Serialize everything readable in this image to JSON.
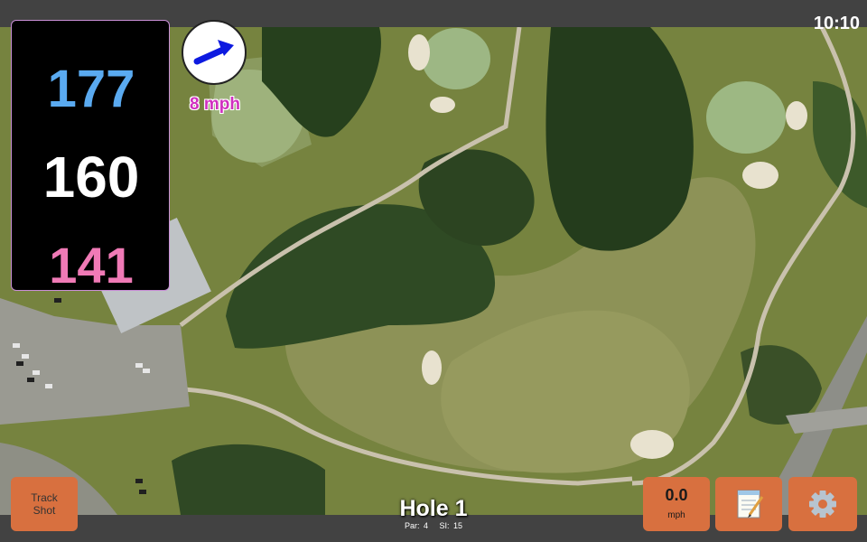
{
  "status_bar": {
    "time": "10:10"
  },
  "distances": {
    "back": "177",
    "center": "160",
    "front": "141",
    "back_color": "#5aaaf0",
    "center_color": "#ffffff",
    "front_color": "#f07ab6"
  },
  "wind": {
    "icon": "wind-direction-arrow-icon",
    "speed": "8 mph"
  },
  "buttons": {
    "track_shot_line1": "Track",
    "track_shot_line2": "Shot",
    "speed_value": "0.0",
    "speed_unit": "mph",
    "notes_icon": "notepad-icon",
    "settings_icon": "gear-icon",
    "accent_color": "#d8703f"
  },
  "hole": {
    "title": "Hole 1",
    "par": "Par: 4",
    "si": "SI: 15"
  }
}
